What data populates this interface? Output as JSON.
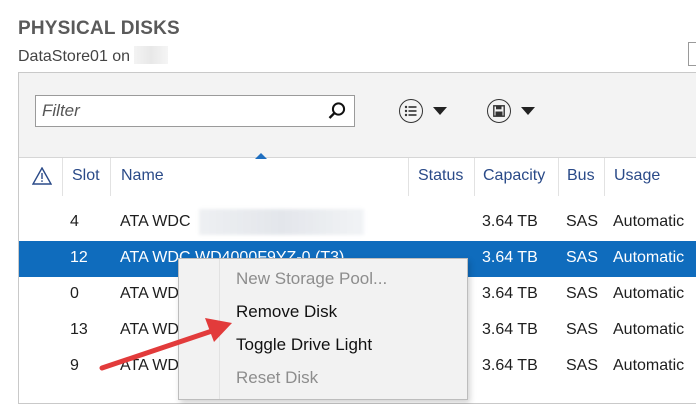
{
  "header": {
    "title": "PHYSICAL DISKS",
    "subtitle": "DataStore01 on"
  },
  "toolbar": {
    "filter_placeholder": "Filter",
    "icons": [
      "search-icon",
      "list-view-icon",
      "save-icon",
      "chevron-down-icon"
    ]
  },
  "columns": {
    "warning_icon": "⚠",
    "slot": "Slot",
    "name": "Name",
    "status": "Status",
    "capacity": "Capacity",
    "bus": "Bus",
    "usage": "Usage"
  },
  "rows": [
    {
      "slot": "4",
      "name": "ATA WDC",
      "capacity": "3.64 TB",
      "bus": "SAS",
      "usage": "Automatic",
      "selected": false
    },
    {
      "slot": "12",
      "name": "ATA WDC WD4000F9YZ-0 (T3)",
      "capacity": "3.64 TB",
      "bus": "SAS",
      "usage": "Automatic",
      "selected": true
    },
    {
      "slot": "0",
      "name": "ATA WD",
      "capacity": "3.64 TB",
      "bus": "SAS",
      "usage": "Automatic",
      "selected": false
    },
    {
      "slot": "13",
      "name": "ATA WD",
      "capacity": "3.64 TB",
      "bus": "SAS",
      "usage": "Automatic",
      "selected": false
    },
    {
      "slot": "9",
      "name": "ATA WD",
      "capacity": "3.64 TB",
      "bus": "SAS",
      "usage": "Automatic",
      "selected": false
    }
  ],
  "context_menu": {
    "items": [
      {
        "label": "New Storage Pool...",
        "enabled": false
      },
      {
        "label": "Remove Disk",
        "enabled": true
      },
      {
        "label": "Toggle Drive Light",
        "enabled": true
      },
      {
        "label": "Reset Disk",
        "enabled": false
      }
    ]
  },
  "colors": {
    "selection": "#0f6cbd",
    "header_text": "#2a4a88",
    "annotation_arrow": "#e23b3b"
  }
}
